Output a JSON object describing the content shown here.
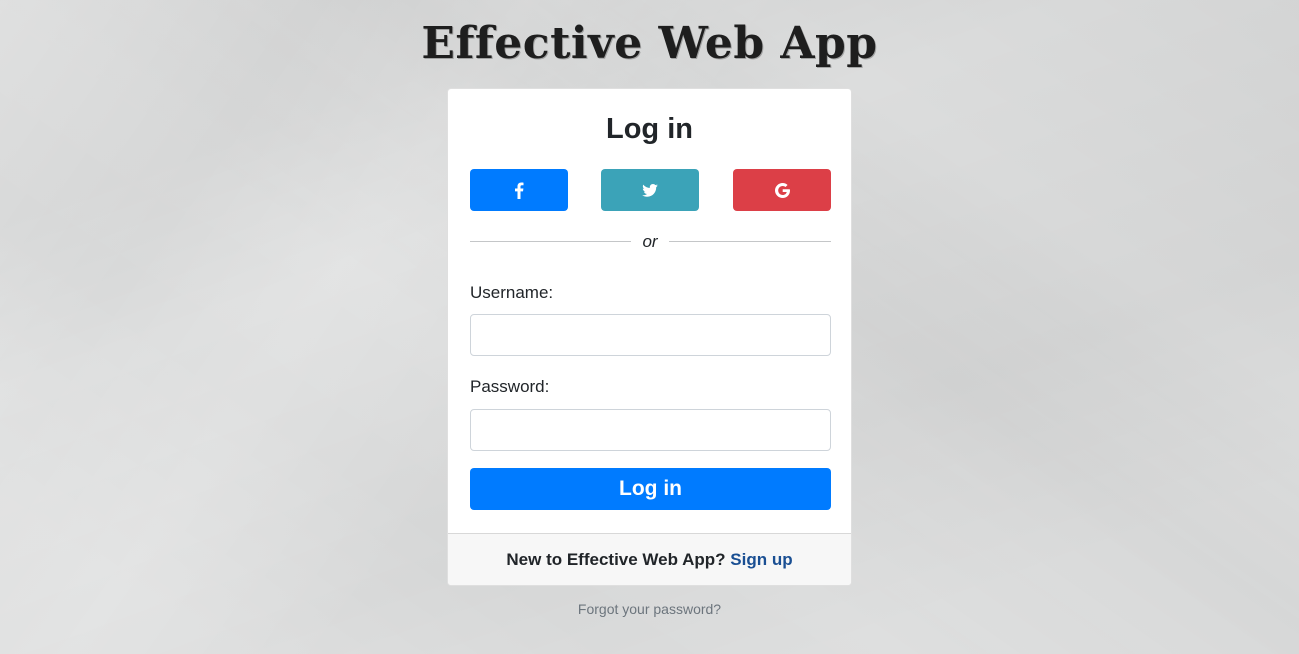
{
  "app": {
    "brand": "Effective Web App"
  },
  "login_card": {
    "title": "Log in",
    "social": {
      "facebook": {
        "icon": "facebook-icon",
        "color": "#007bff"
      },
      "twitter": {
        "icon": "twitter-icon",
        "color": "#3ba3b8"
      },
      "google": {
        "icon": "google-icon",
        "color": "#dc3f47"
      }
    },
    "divider_text": "or",
    "username": {
      "label": "Username:",
      "value": "",
      "placeholder": ""
    },
    "password": {
      "label": "Password:",
      "value": "",
      "placeholder": ""
    },
    "submit_label": "Log in",
    "submit_color": "#007bff"
  },
  "footer": {
    "prompt": "New to Effective Web App?",
    "signup_label": "Sign up",
    "link_color": "#1a4f93"
  },
  "forgot_password_label": "Forgot your password?"
}
